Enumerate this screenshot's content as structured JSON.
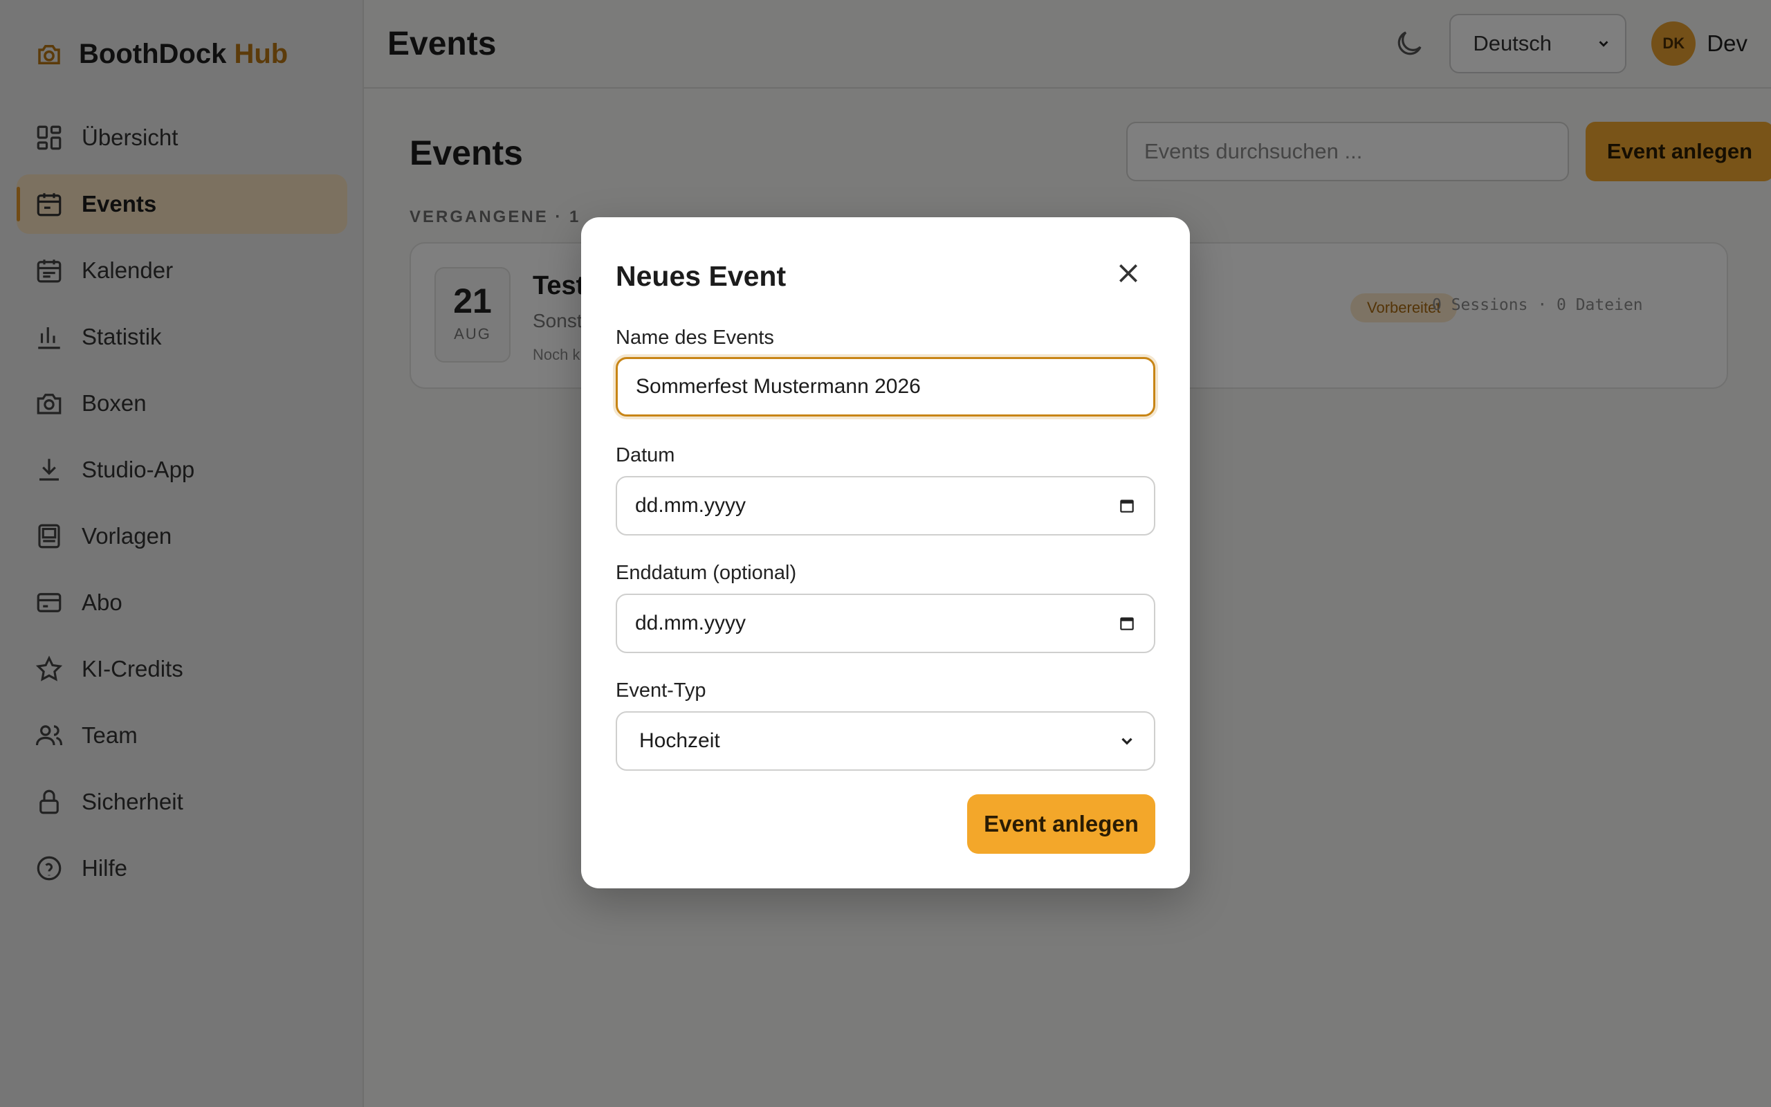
{
  "brand": {
    "name_part1": "BoothDock",
    "name_part2": "Hub"
  },
  "sidebar": {
    "items": [
      {
        "label": "Übersicht",
        "icon": "grid-icon"
      },
      {
        "label": "Events",
        "icon": "calendar-icon",
        "active": true
      },
      {
        "label": "Kalender",
        "icon": "calendar-lines-icon"
      },
      {
        "label": "Statistik",
        "icon": "bar-chart-icon"
      },
      {
        "label": "Boxen",
        "icon": "camera-icon"
      },
      {
        "label": "Studio-App",
        "icon": "download-icon"
      },
      {
        "label": "Vorlagen",
        "icon": "template-icon"
      },
      {
        "label": "Abo",
        "icon": "credit-card-icon"
      },
      {
        "label": "KI-Credits",
        "icon": "star-icon"
      },
      {
        "label": "Team",
        "icon": "users-icon"
      },
      {
        "label": "Sicherheit",
        "icon": "lock-icon"
      },
      {
        "label": "Hilfe",
        "icon": "help-icon"
      }
    ]
  },
  "header": {
    "title": "Events",
    "language": "Deutsch",
    "avatar_initials": "DK",
    "username": "Dev"
  },
  "page": {
    "title": "Events",
    "search_placeholder": "Events durchsuchen ...",
    "add_button": "Event anlegen",
    "section_label": "VERGANGENE · 1",
    "event": {
      "day": "21",
      "month": "AUG",
      "title": "Test",
      "subtitle": "Sonst",
      "note": "Noch k",
      "status": "Vorbereitet",
      "meta": "0 Sessions · 0 Dateien"
    }
  },
  "modal": {
    "title": "Neues Event",
    "name_label": "Name des Events",
    "name_value": "Sommerfest Mustermann 2026",
    "date_label": "Datum",
    "date_value": "dd.mm.yyyy",
    "enddate_label": "Enddatum (optional)",
    "enddate_value": "dd.mm.yyyy",
    "type_label": "Event-Typ",
    "type_value": "Hochzeit",
    "submit": "Event anlegen"
  },
  "colors": {
    "accent": "#f3a72a",
    "accent_dark": "#b87714",
    "focus_ring": "#c88516"
  }
}
